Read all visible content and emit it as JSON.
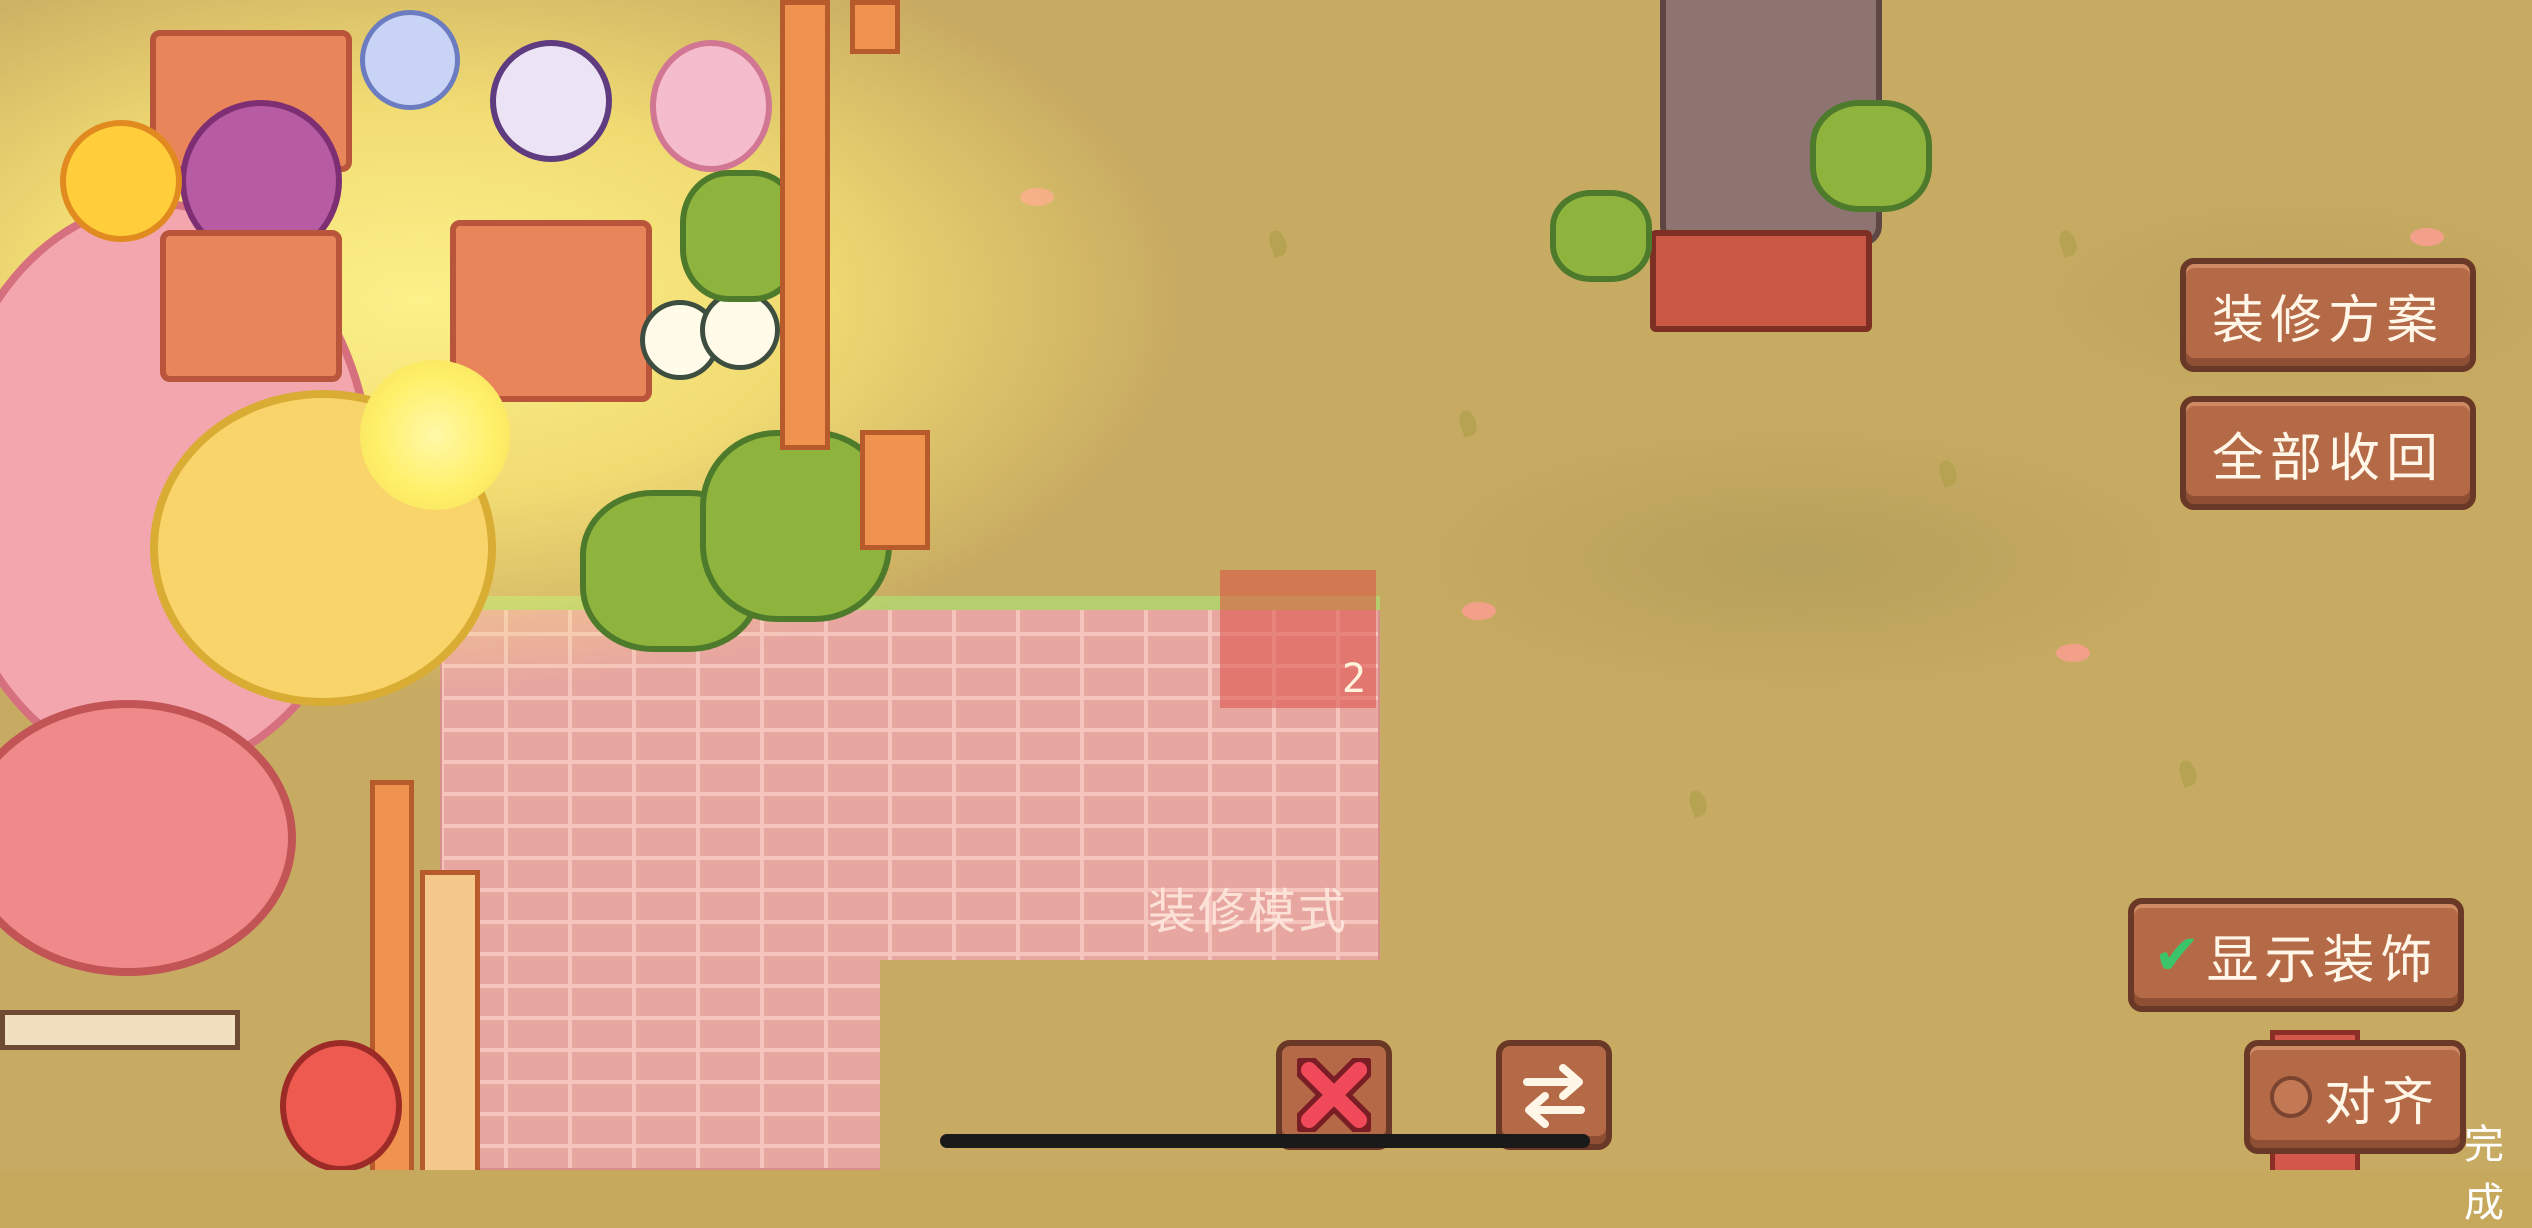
{
  "scene": {
    "tile_number": "2",
    "mode_label": "装修模式"
  },
  "buttons": {
    "decoration_plan": "装修方案",
    "recall_all": "全部收回",
    "show_decorations": "显示装饰",
    "show_decorations_checked": true,
    "align": "对齐",
    "align_checked": false,
    "done_partial": "完成"
  },
  "icons": {
    "cancel": "close-x-icon",
    "swap": "swap-arrows-icon",
    "check": "checkmark-icon",
    "radio": "radio-circle-icon"
  },
  "colors": {
    "button_fill": "#b56a47",
    "button_border": "#6a3826",
    "grass": "#c8ab62",
    "brick": "#e7a6a0",
    "cancel_icon": "#f04a5a",
    "check_icon": "#3cc46a"
  }
}
